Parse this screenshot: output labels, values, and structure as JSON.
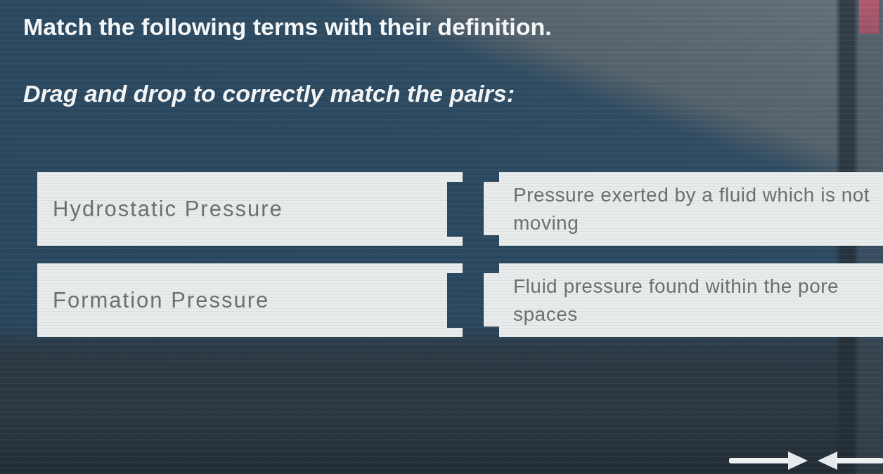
{
  "question": {
    "title": "Match the following terms with their definition.",
    "instruction": "Drag and drop to correctly match the pairs:"
  },
  "pairs": [
    {
      "term": "Hydrostatic Pressure",
      "definition": "Pressure exerted by a fluid which is not moving"
    },
    {
      "term": "Formation Pressure",
      "definition": "Fluid pressure found within the pore spaces"
    }
  ]
}
